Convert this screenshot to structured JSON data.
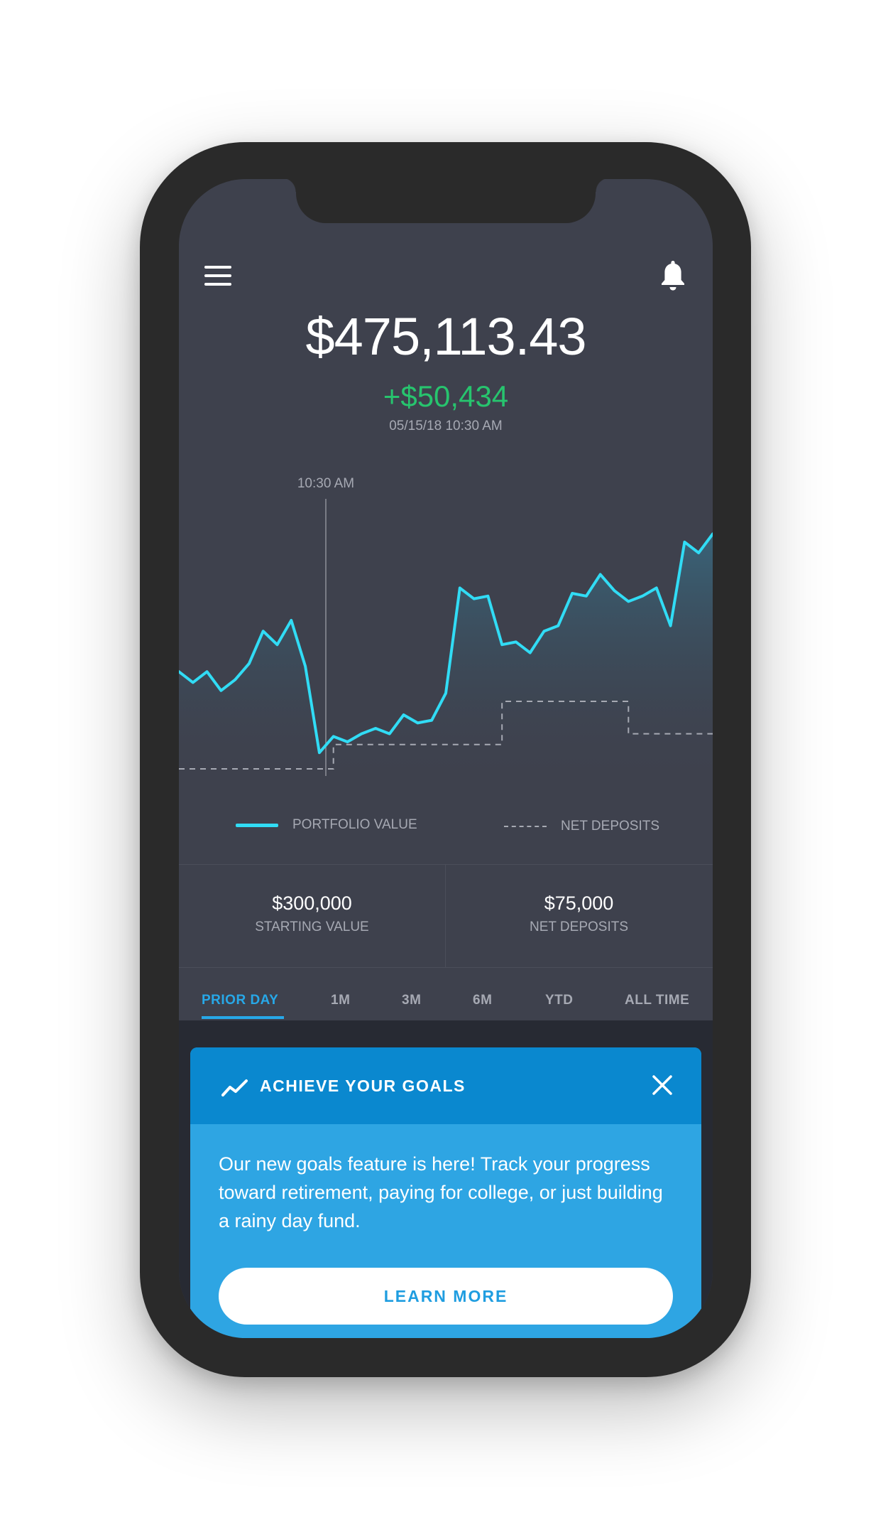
{
  "header": {
    "menu_icon": "hamburger-icon",
    "notification_icon": "bell-icon"
  },
  "portfolio": {
    "balance": "$475,113.43",
    "change": "+$50,434",
    "timestamp": "05/15/18 10:30 AM"
  },
  "chart_data": {
    "type": "line",
    "marker_label": "10:30 AM",
    "series": [
      {
        "name": "PORTFOLIO VALUE",
        "color": "#31dcf5",
        "values": [
          0.36,
          0.32,
          0.36,
          0.29,
          0.33,
          0.39,
          0.51,
          0.46,
          0.55,
          0.38,
          0.06,
          0.12,
          0.1,
          0.13,
          0.15,
          0.13,
          0.2,
          0.17,
          0.18,
          0.28,
          0.67,
          0.63,
          0.64,
          0.46,
          0.47,
          0.43,
          0.51,
          0.53,
          0.65,
          0.64,
          0.72,
          0.66,
          0.62,
          0.64,
          0.67,
          0.53,
          0.84,
          0.8,
          0.87
        ]
      },
      {
        "name": "NET DEPOSITS",
        "color": "#a6a9b3",
        "style": "dashed",
        "values": [
          0.0,
          0.0,
          0.0,
          0.0,
          0.0,
          0.0,
          0.0,
          0.0,
          0.0,
          0.0,
          0.0,
          0.09,
          0.09,
          0.09,
          0.09,
          0.09,
          0.09,
          0.09,
          0.09,
          0.09,
          0.09,
          0.09,
          0.09,
          0.25,
          0.25,
          0.25,
          0.25,
          0.25,
          0.25,
          0.25,
          0.25,
          0.25,
          0.13,
          0.13,
          0.13,
          0.13,
          0.13,
          0.13,
          0.13
        ]
      }
    ],
    "ylim": [
      0,
      1
    ],
    "grid": false,
    "legend_placement": "bottom"
  },
  "legend": {
    "portfolio_label": "PORTFOLIO VALUE",
    "deposits_label": "NET DEPOSITS"
  },
  "stats": {
    "starting_value": "$300,000",
    "starting_label": "STARTING VALUE",
    "net_deposits": "$75,000",
    "net_deposits_label": "NET DEPOSITS"
  },
  "tabs": [
    {
      "label": "PRIOR DAY",
      "active": true
    },
    {
      "label": "1M",
      "active": false
    },
    {
      "label": "3M",
      "active": false
    },
    {
      "label": "6M",
      "active": false
    },
    {
      "label": "YTD",
      "active": false
    },
    {
      "label": "ALL TIME",
      "active": false
    }
  ],
  "goals_card": {
    "icon": "trend-up-icon",
    "title": "ACHIEVE YOUR GOALS",
    "close_icon": "close-icon",
    "body": "Our new goals feature is here! Track your progress toward retirement, paying for college, or just building a rainy day fund.",
    "button_label": "LEARN MORE"
  },
  "colors": {
    "background": "#3e414d",
    "accent": "#27a8e8",
    "positive": "#27c46e",
    "line": "#31dcf5",
    "card": "#2ea5e3",
    "card_header": "#0a88cf"
  }
}
